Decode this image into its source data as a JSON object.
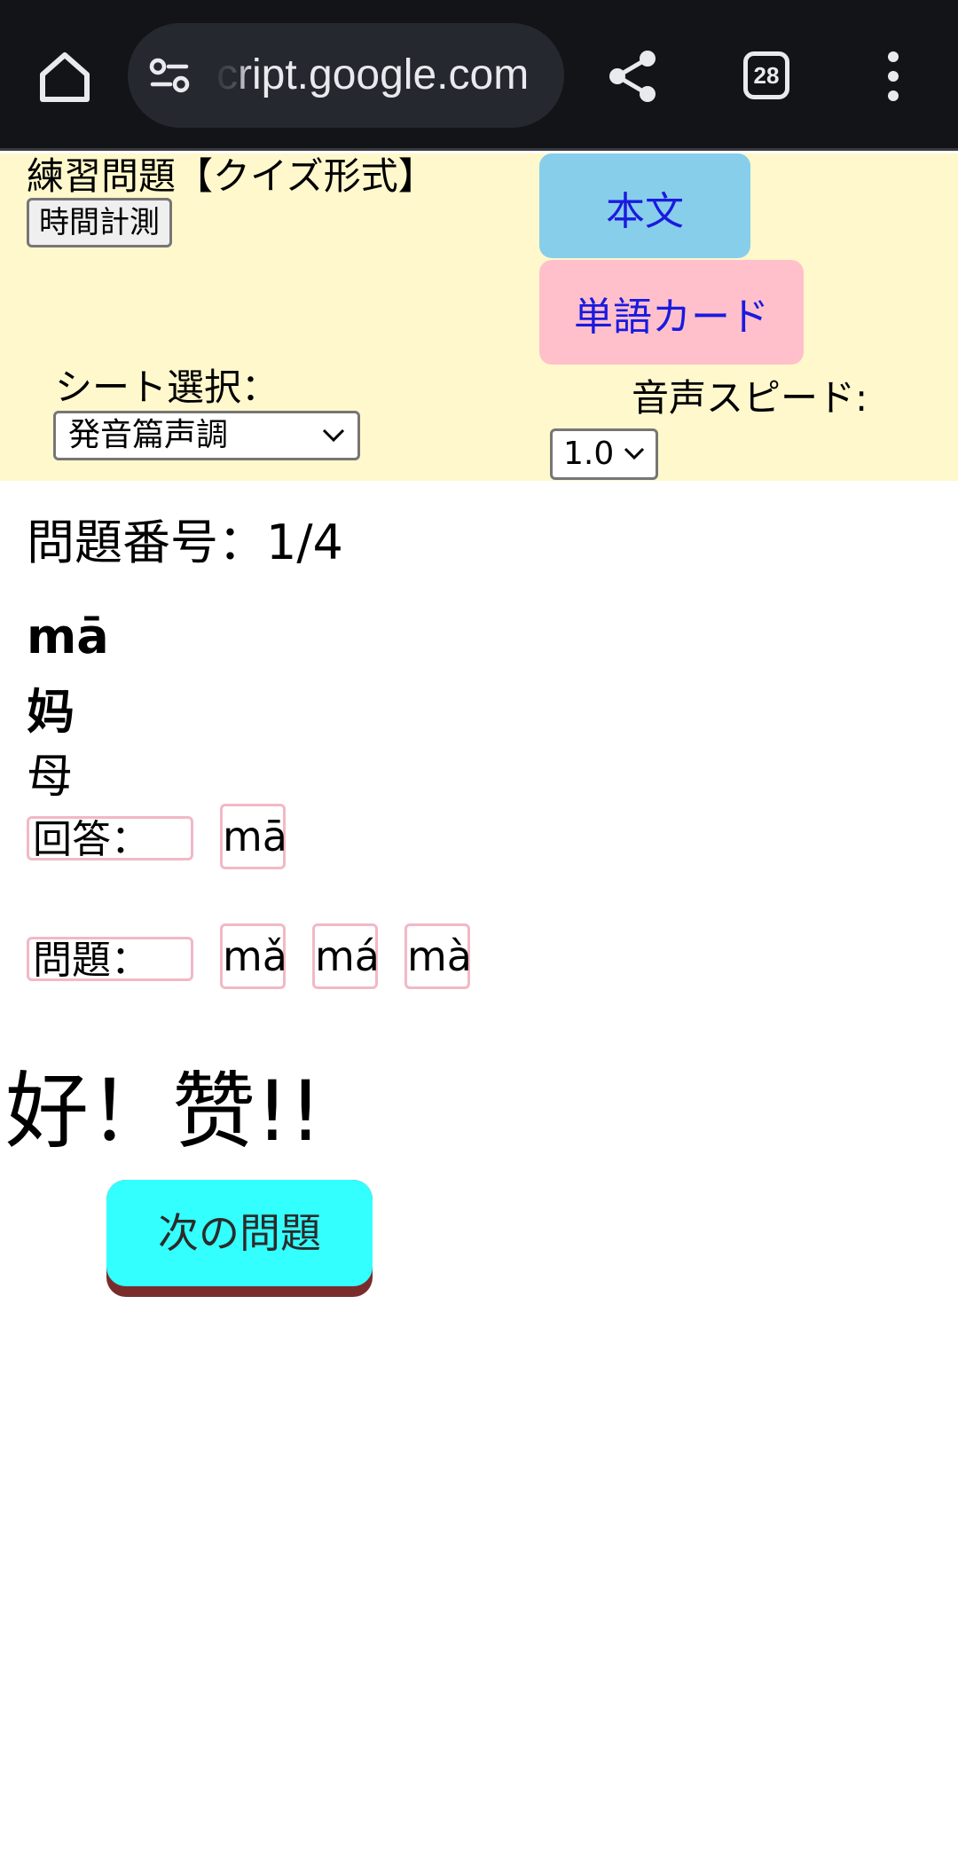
{
  "browser": {
    "url_fragment": "ript.google.com",
    "url_faded_prefix": "c",
    "tab_count": "28",
    "icons": [
      "home-icon",
      "site-settings-icon",
      "share-icon",
      "tab-switcher-icon",
      "more-menu-icon"
    ]
  },
  "header": {
    "title": "練習問題【クイズ形式】",
    "timer_button": "時間計測",
    "text_button": "本文",
    "card_button": "単語カード",
    "sheet_label": "シート選択：",
    "sheet_value": "発音篇声調",
    "speed_label": "音声スピード:",
    "speed_value": "1.0"
  },
  "quiz": {
    "question_number": "問題番号：1/4",
    "pinyin": "mā",
    "hanzi": "妈",
    "meaning": "母",
    "answer_label": "回答：",
    "answer_value": "mā",
    "question_label": "問題：",
    "options": [
      "mǎ",
      "má",
      "mà"
    ],
    "feedback": "好！赞!!",
    "next_button": "次の問題"
  },
  "colors": {
    "chrome_bg": "#131418",
    "panel_bg": "#fff8cc",
    "text_button_bg": "#87ceeb",
    "card_button_bg": "#ffc0cb",
    "link_text": "#1a1adf",
    "next_button_bg": "#33ffff",
    "next_button_shadow": "#7a2c2c",
    "chip_border": "#f2b8c6"
  }
}
